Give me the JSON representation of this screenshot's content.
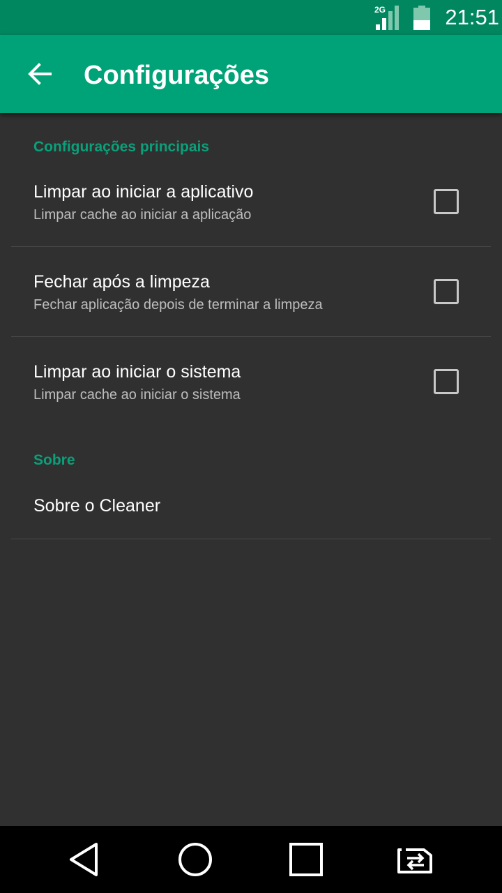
{
  "status_bar": {
    "network_label": "2G",
    "time": "21:51",
    "icons": [
      "signal-icon",
      "battery-icon"
    ]
  },
  "app_bar": {
    "back_icon": "arrow-back-icon",
    "title": "Configurações"
  },
  "sections": [
    {
      "header": "Configurações principais",
      "items": [
        {
          "title": "Limpar ao iniciar a aplicativo",
          "summary": "Limpar cache ao iniciar a aplicação",
          "checked": false
        },
        {
          "title": "Fechar após a limpeza",
          "summary": "Fechar aplicação depois de terminar a limpeza",
          "checked": false
        },
        {
          "title": "Limpar ao iniciar o sistema",
          "summary": "Limpar cache ao iniciar o sistema",
          "checked": false
        }
      ]
    },
    {
      "header": "Sobre",
      "items": [
        {
          "title": "Sobre o Cleaner"
        }
      ]
    }
  ],
  "nav_bar": {
    "icons": [
      "back-triangle-icon",
      "home-circle-icon",
      "recents-square-icon",
      "switch-app-icon"
    ]
  },
  "colors": {
    "status_bar": "#00875f",
    "app_bar": "#00a277",
    "accent": "#0aa07a",
    "background": "#303030",
    "summary_text": "#bdbdbd",
    "nav_bar": "#000000"
  }
}
